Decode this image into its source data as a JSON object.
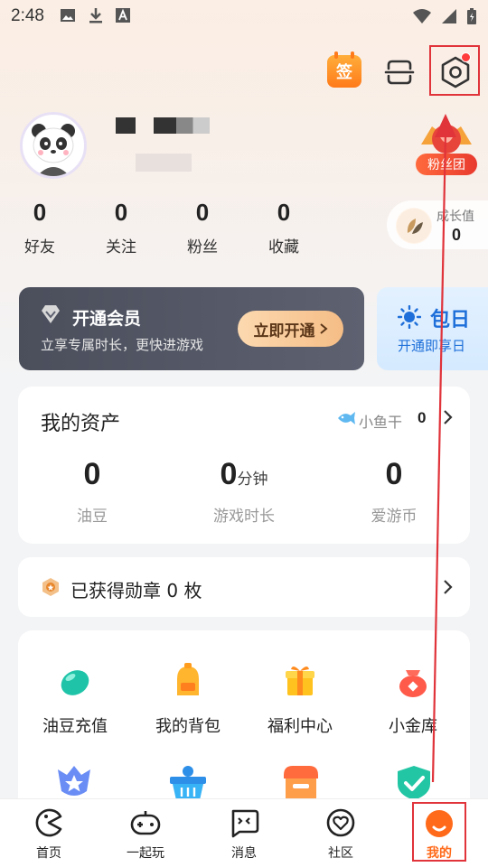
{
  "status_bar": {
    "time": "2:48"
  },
  "header": {
    "sign_label": "签"
  },
  "profile": {
    "fan_club_label": "粉丝团"
  },
  "stats": [
    {
      "value": "0",
      "label": "好友"
    },
    {
      "value": "0",
      "label": "关注"
    },
    {
      "value": "0",
      "label": "粉丝"
    },
    {
      "value": "0",
      "label": "收藏"
    }
  ],
  "growth": {
    "label": "成长值",
    "value": "0"
  },
  "vip": {
    "title": "开通会员",
    "subtitle": "立享专属时长，更快进游戏",
    "button": "立即开通"
  },
  "package": {
    "title": "包日",
    "subtitle": "开通即享日"
  },
  "assets": {
    "title": "我的资产",
    "fish_label": "小鱼干",
    "fish_value": "0",
    "items": [
      {
        "value": "0",
        "unit": "",
        "label": "油豆"
      },
      {
        "value": "0",
        "unit": "分钟",
        "label": "游戏时长"
      },
      {
        "value": "0",
        "unit": "",
        "label": "爱游币"
      }
    ]
  },
  "medal": {
    "text": "已获得勋章 0 枚"
  },
  "grid": [
    {
      "label": "油豆充值",
      "icon": "bean-icon"
    },
    {
      "label": "我的背包",
      "icon": "backpack-icon"
    },
    {
      "label": "福利中心",
      "icon": "gift-icon"
    },
    {
      "label": "小金库",
      "icon": "money-bag-icon"
    }
  ],
  "nav": [
    {
      "label": "首页",
      "icon": "home-pacman-icon"
    },
    {
      "label": "一起玩",
      "icon": "gamepad-icon"
    },
    {
      "label": "消息",
      "icon": "message-icon"
    },
    {
      "label": "社区",
      "icon": "community-heart-icon"
    },
    {
      "label": "我的",
      "icon": "profile-icon"
    }
  ],
  "colors": {
    "accent": "#ff6a1a",
    "annotation": "#e0333a",
    "vip_bg": "#4b4f5c",
    "package_blue": "#1e6fd9"
  }
}
